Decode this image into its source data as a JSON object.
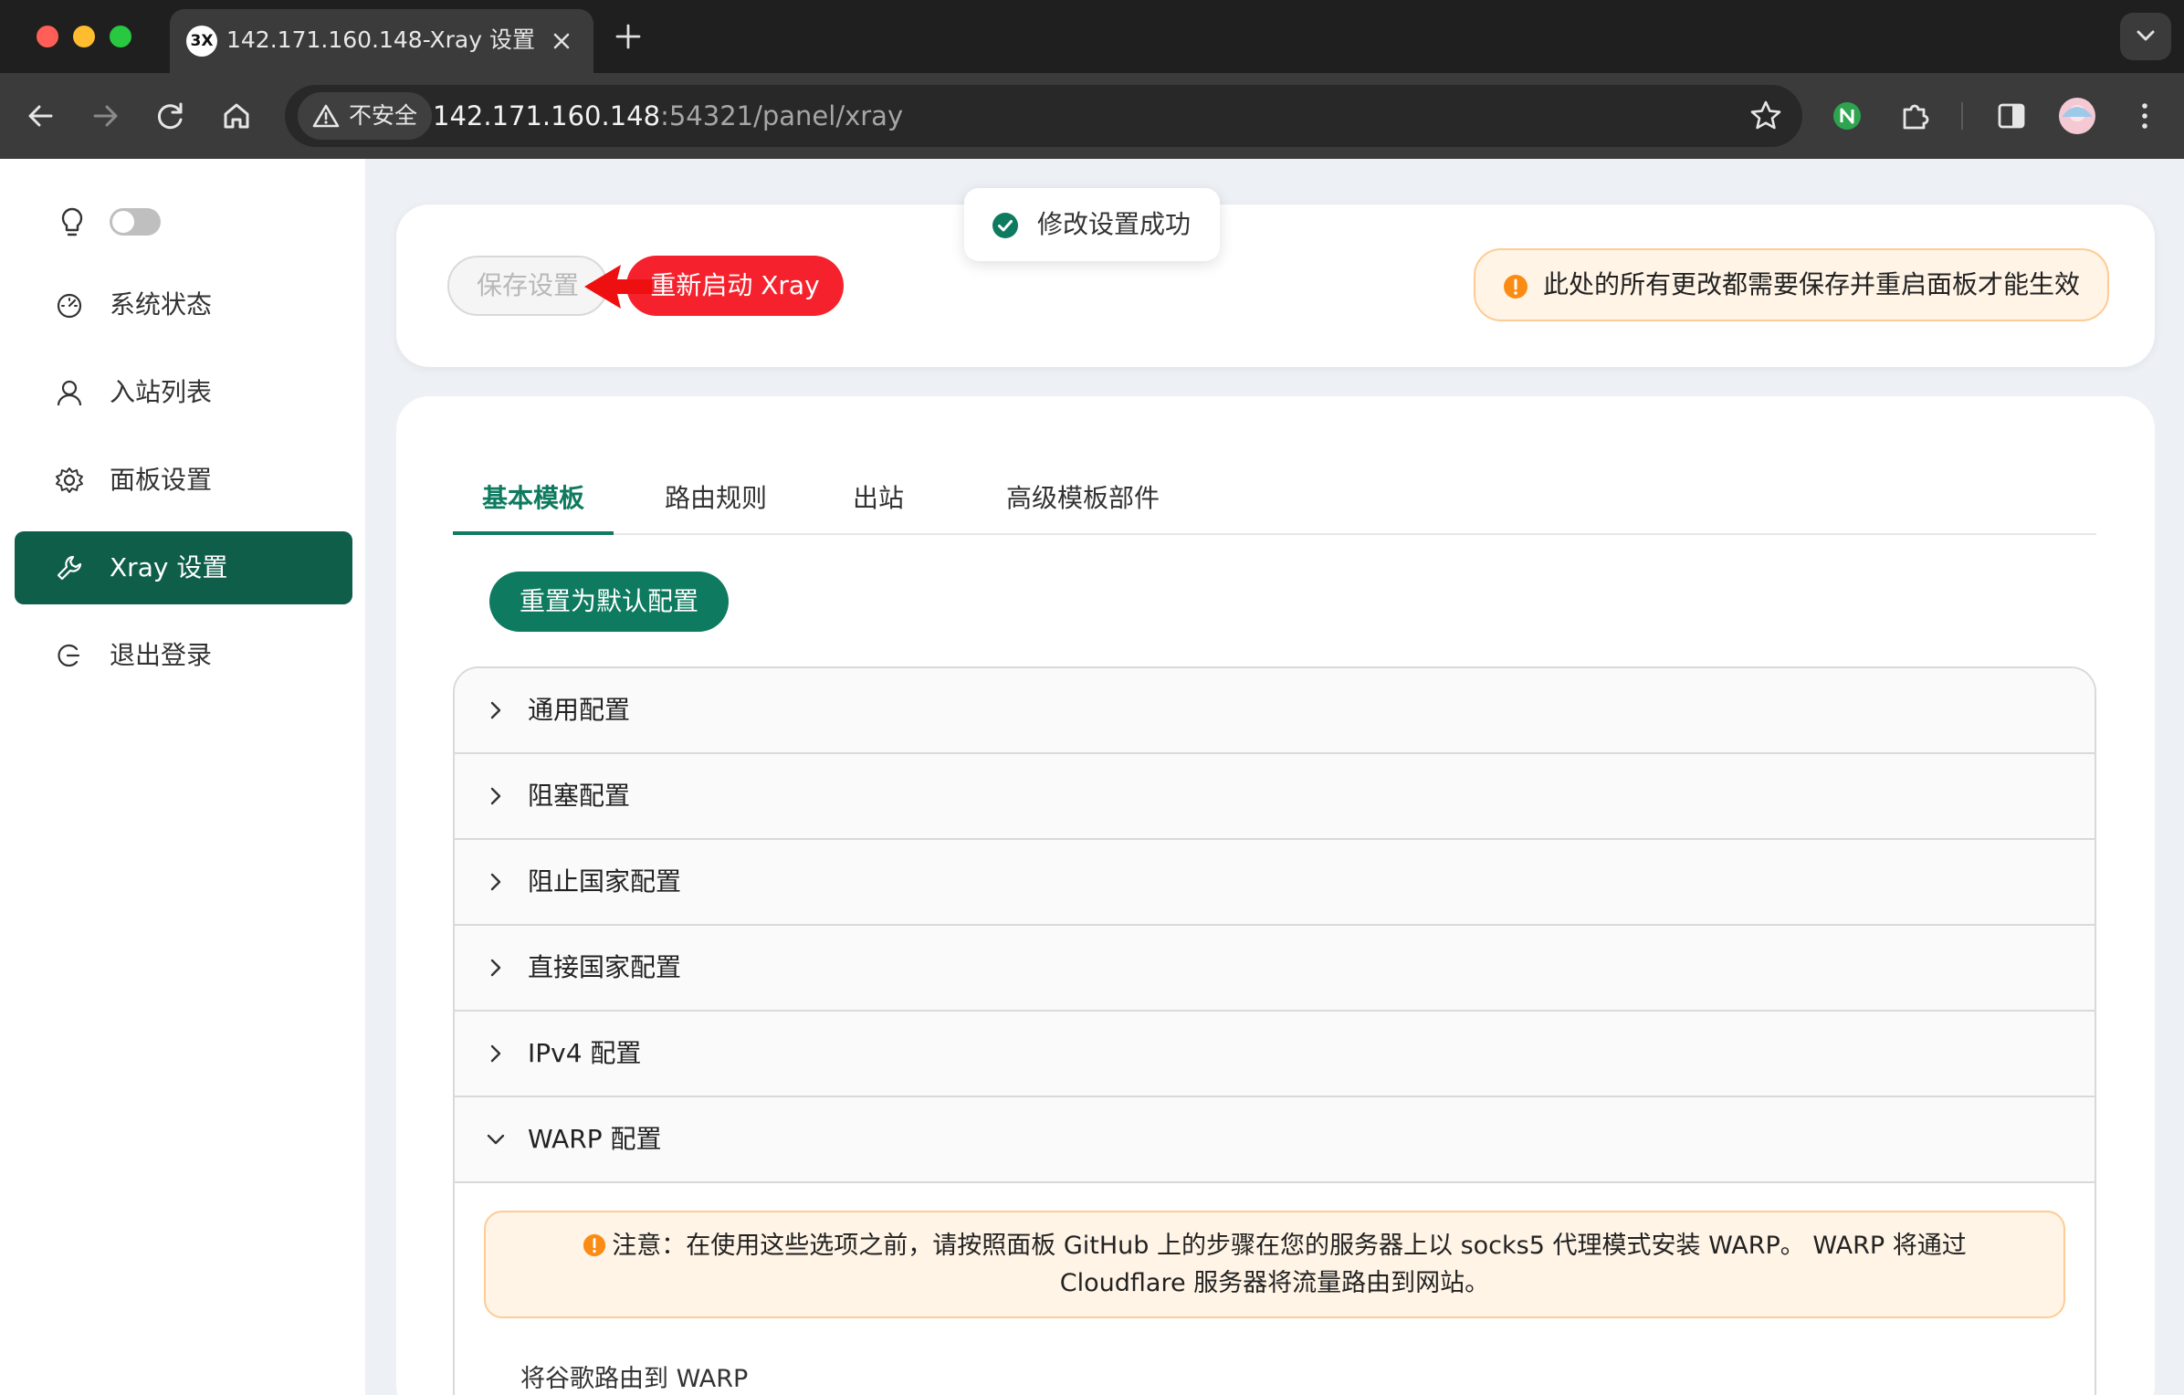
{
  "browser": {
    "tab": {
      "favicon_text": "3X",
      "title": "142.171.160.148-Xray 设置"
    },
    "security_label": "不安全",
    "url_host": "142.171.160.148",
    "url_rest": ":54321/panel/xray"
  },
  "sidebar": {
    "items": [
      {
        "label": "系统状态",
        "icon": "dashboard-icon"
      },
      {
        "label": "入站列表",
        "icon": "user-icon"
      },
      {
        "label": "面板设置",
        "icon": "gear-icon"
      },
      {
        "label": "Xray 设置",
        "icon": "tool-icon",
        "active": true
      },
      {
        "label": "退出登录",
        "icon": "logout-icon"
      }
    ]
  },
  "toolbar": {
    "save_label": "保存设置",
    "restart_label": "重新启动 Xray",
    "notice": "此处的所有更改都需要保存并重启面板才能生效"
  },
  "toast": {
    "message": "修改设置成功"
  },
  "tabs": [
    {
      "label": "基本模板",
      "active": true
    },
    {
      "label": "路由规则"
    },
    {
      "label": "出站"
    },
    {
      "label": "高级模板部件"
    }
  ],
  "reset_label": "重置为默认配置",
  "panels": [
    {
      "label": "通用配置",
      "expanded": false
    },
    {
      "label": "阻塞配置",
      "expanded": false
    },
    {
      "label": "阻止国家配置",
      "expanded": false
    },
    {
      "label": "直接国家配置",
      "expanded": false
    },
    {
      "label": "IPv4 配置",
      "expanded": false
    },
    {
      "label": "WARP 配置",
      "expanded": true
    }
  ],
  "warp": {
    "alert_line1": "注意：在使用这些选项之前，请按照面板 GitHub 上的步骤在您的服务器上以 socks5 代理模式安装 WARP。 WARP 将通过",
    "alert_line2": "Cloudflare 服务器将流量路由到网站。",
    "field_label": "将谷歌路由到 WARP"
  },
  "colors": {
    "primary": "#0e7a5f",
    "sidebar_active": "#0e5e4a",
    "danger": "#f5222d",
    "warning": "#fa8c16",
    "warning_bg": "#fff4e6"
  }
}
